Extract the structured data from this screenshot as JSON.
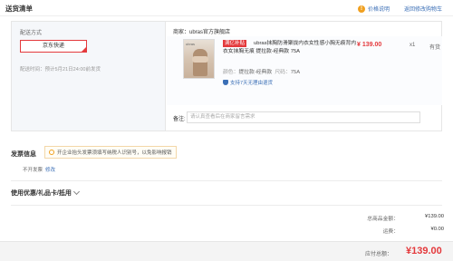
{
  "header": {
    "title": "送货清单",
    "price_note": "价格说明",
    "back_to_cart": "返回修改购物车"
  },
  "delivery": {
    "label": "配送方式",
    "method": "京东快递",
    "time": "配送时间：预计5月21日24:00前发货"
  },
  "shop": {
    "label": "商家：ubras官方旗舰店"
  },
  "product": {
    "image_brand": "ubras",
    "tag": "满亿补贴",
    "name": "ubras抹胸防滑聚拢内衣女性感小胸无痕背内衣女抹胸无痕 提拉款-经典款 75A",
    "spec": {
      "color_key": "颜色：",
      "color_value": "提拉款-经典款",
      "size_key": "尺码：",
      "size_value": "75A"
    },
    "guarantee": "支持7天无理由退货",
    "price": "¥ 139.00",
    "qty": "x1",
    "stock": "有货"
  },
  "remark": {
    "label": "备注:",
    "placeholder": "请认真查看后在商家留言需求"
  },
  "invoice": {
    "title": "发票信息",
    "tip": "开企业抬头发票须填写纳税人识别号，以免影响报销",
    "status": "不开发票",
    "edit": "修改"
  },
  "coupon": {
    "title": "使用优惠/礼品卡/抵用"
  },
  "summary": {
    "goods_total_label": "总商品金额：",
    "goods_total_value": "¥139.00",
    "shipping_label": "运费：",
    "shipping_value": "¥0.00",
    "payable_label": "应付总额：",
    "payable_value": "¥139.00"
  },
  "colors": {
    "accent": "#e4393c",
    "link": "#3b6fb6",
    "warning": "#f0a020"
  }
}
